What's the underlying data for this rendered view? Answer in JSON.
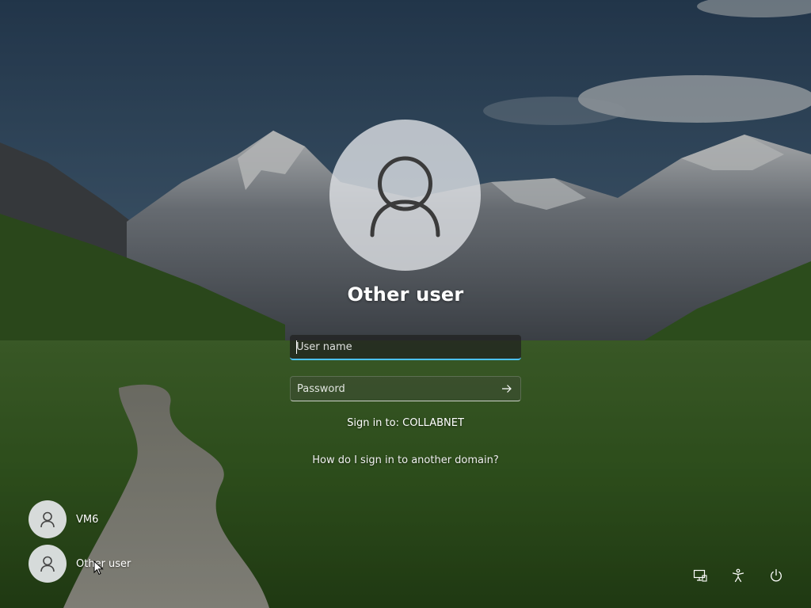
{
  "login": {
    "username": "Other user",
    "username_placeholder": "User name",
    "password_placeholder": "Password",
    "sign_in_to": "Sign in to: COLLABNET",
    "domain_help_link": "How do I sign in to another domain?"
  },
  "user_tiles": [
    {
      "label": "VM6"
    },
    {
      "label": "Other user"
    }
  ],
  "system_buttons": {
    "network_icon": "network-icon",
    "accessibility_icon": "accessibility-icon",
    "power_icon": "power-icon"
  },
  "colors": {
    "focus_accent": "#4cc2ff"
  }
}
